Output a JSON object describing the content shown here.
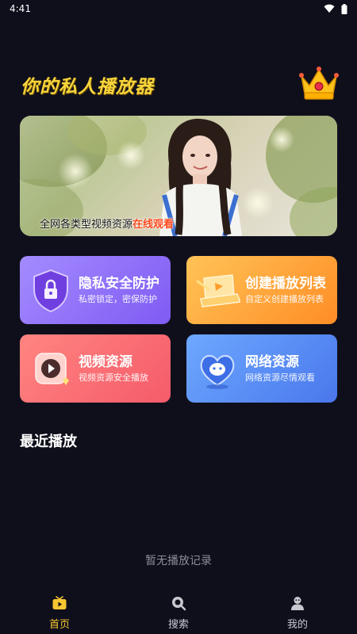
{
  "status_bar": {
    "time": "4:41"
  },
  "header": {
    "title": "你的私人播放器"
  },
  "banner": {
    "caption_prefix": "全网各类型视频资源",
    "caption_highlight": "在线观看"
  },
  "cards": [
    {
      "title": "隐私安全防护",
      "subtitle": "私密锁定，密保防护"
    },
    {
      "title": "创建播放列表",
      "subtitle": "自定义创建播放列表"
    },
    {
      "title": "视频资源",
      "subtitle": "视频资源安全播放"
    },
    {
      "title": "网络资源",
      "subtitle": "网络资源尽情观看"
    }
  ],
  "recent": {
    "title": "最近播放",
    "empty": "暂无播放记录"
  },
  "tabbar": {
    "items": [
      {
        "label": "首页",
        "icon": "tv-icon",
        "active": true
      },
      {
        "label": "搜索",
        "icon": "search-icon",
        "active": false
      },
      {
        "label": "我的",
        "icon": "user-icon",
        "active": false
      }
    ]
  },
  "colors": {
    "background": "#0f0f1c",
    "accent": "#f7c631",
    "highlight": "#ff4a1e"
  }
}
